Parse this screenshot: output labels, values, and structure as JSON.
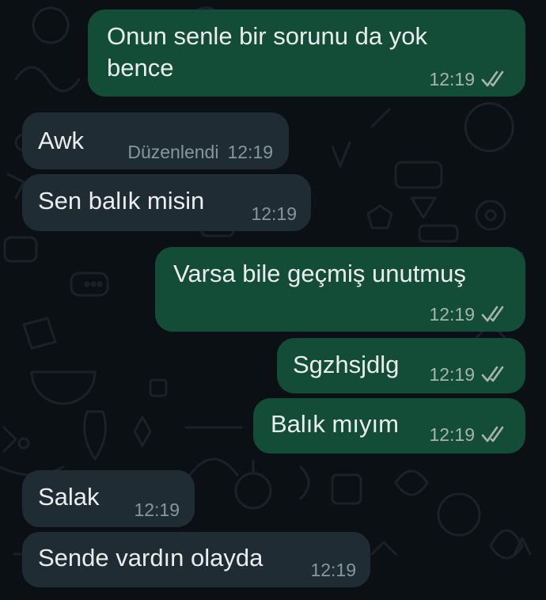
{
  "theme": {
    "outgoing_bubble": "#144d37",
    "incoming_bubble": "#202c33",
    "background": "#0b1014",
    "text": "#e9edef",
    "meta_text": "#8696a0",
    "tick_icon": "double-check-icon"
  },
  "messages": [
    {
      "direction": "outgoing",
      "text": "Onun senle bir sorunu da yok",
      "text_line2": "bence",
      "time": "12:19",
      "status": "read"
    },
    {
      "direction": "incoming",
      "text": "Awk",
      "edited_label": "Düzenlendi",
      "time": "12:19"
    },
    {
      "direction": "incoming",
      "text": "Sen balık misin",
      "time": "12:19"
    },
    {
      "direction": "outgoing",
      "text": "Varsa bile geçmiş unutmuş",
      "time": "12:19",
      "status": "read"
    },
    {
      "direction": "outgoing",
      "text": "Sgzhsjdlg",
      "time": "12:19",
      "status": "read"
    },
    {
      "direction": "outgoing",
      "text": "Balık mıyım",
      "time": "12:19",
      "status": "read"
    },
    {
      "direction": "incoming",
      "text": "Salak",
      "time": "12:19"
    },
    {
      "direction": "incoming",
      "text": "Sende vardın olayda",
      "time": "12:19"
    }
  ]
}
